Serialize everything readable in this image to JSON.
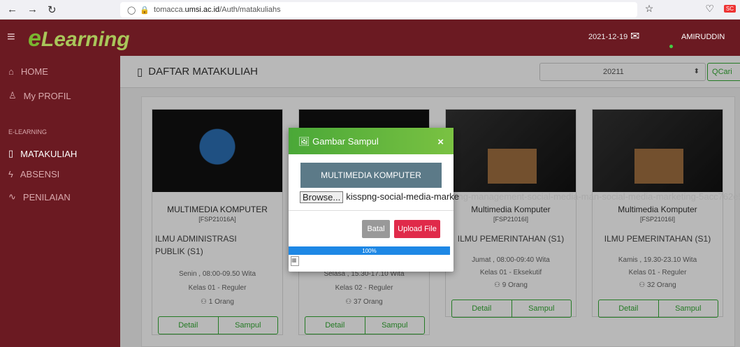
{
  "browser": {
    "url_prefix": "tomacca.",
    "url_domain": "umsi.ac.id",
    "url_path": "/Auth/matakuliahs",
    "ext": "SC"
  },
  "header": {
    "logo": "Learning",
    "date": "2021-12-19",
    "user": "AMIRUDDIN"
  },
  "sidebar": {
    "items": [
      {
        "label": "HOME"
      },
      {
        "label": "My PROFIL"
      }
    ],
    "section": "E-LEARNING",
    "items2": [
      {
        "label": "MATAKULIAH"
      },
      {
        "label": "ABSENSI"
      },
      {
        "label": "PENILAIAN"
      }
    ]
  },
  "page": {
    "title": "DAFTAR MATAKULIAH",
    "semester": "20211",
    "search_label": "Cari"
  },
  "cards": [
    {
      "title": "MULTIMEDIA KOMPUTER",
      "code": "[FSP21016A]",
      "program_l1": "ILMU ADMINISTRASI",
      "program_l2": "PUBLIK (S1)",
      "schedule": "Senin , 08:00-09.50 Wita",
      "class": "Kelas 01 - Reguler",
      "count": "1 Orang",
      "detail": "Detail",
      "cover": "Sampul"
    },
    {
      "title": "",
      "code": "",
      "program_l1": "",
      "program_l2": "",
      "schedule": "Selasa , 15.30-17.10 Wita",
      "class": "Kelas 02 - Reguler",
      "count": "37 Orang",
      "detail": "Detail",
      "cover": "Sampul"
    },
    {
      "title": "Multimedia Komputer",
      "code": "[FSP21016I]",
      "program_l1": "ILMU PEMERINTAHAN (S1)",
      "program_l2": "",
      "schedule": "Jumat , 08:00-09:40 Wita",
      "class": "Kelas 01 - Eksekutif",
      "count": "9 Orang",
      "detail": "Detail",
      "cover": "Sampul"
    },
    {
      "title": "Multimedia Komputer",
      "code": "[FSP21016I]",
      "program_l1": "ILMU PEMERINTAHAN (S1)",
      "program_l2": "",
      "schedule": "Kamis , 19.30-23.10 Wita",
      "class": "Kelas 01 - Reguler",
      "count": "32 Orang",
      "detail": "Detail",
      "cover": "Sampul"
    }
  ],
  "modal": {
    "title": "Gambar Sampul",
    "course": "MULTIMEDIA KOMPUTER",
    "browse": "Browse...",
    "file_start": "kisspng-social-media-marke",
    "file_rest": "ting-management-social-media-man-social-media-marketing-5acc762e5",
    "cancel": "Batal",
    "upload": "Upload File",
    "progress": "100%",
    "progress_value": 1.0
  }
}
